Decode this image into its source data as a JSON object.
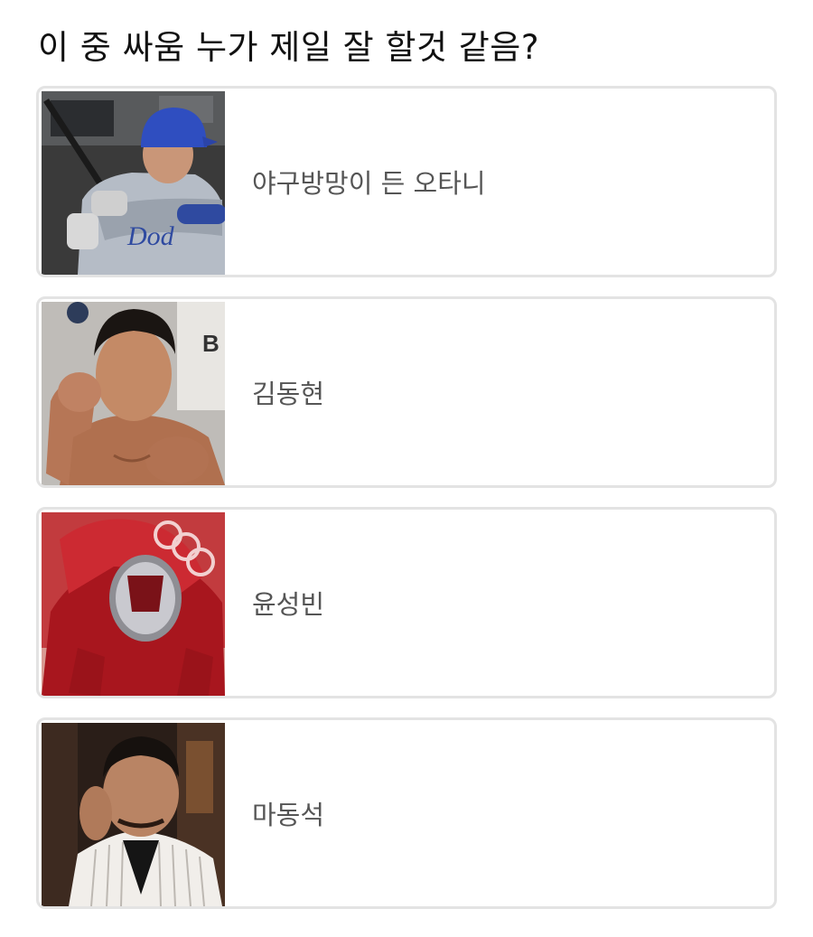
{
  "question": "이 중 싸움 누가 제일 잘 할것 같음?",
  "options": [
    {
      "label": "야구방망이 든 오타니",
      "photo": "baseball-player-photo"
    },
    {
      "label": "김동현",
      "photo": "fighter-photo"
    },
    {
      "label": "윤성빈",
      "photo": "skeleton-athlete-photo"
    },
    {
      "label": "마동석",
      "photo": "actor-photo"
    }
  ],
  "colors": {
    "card_border": "#e3e3e3",
    "question_text": "#111111",
    "option_text": "#555555"
  }
}
